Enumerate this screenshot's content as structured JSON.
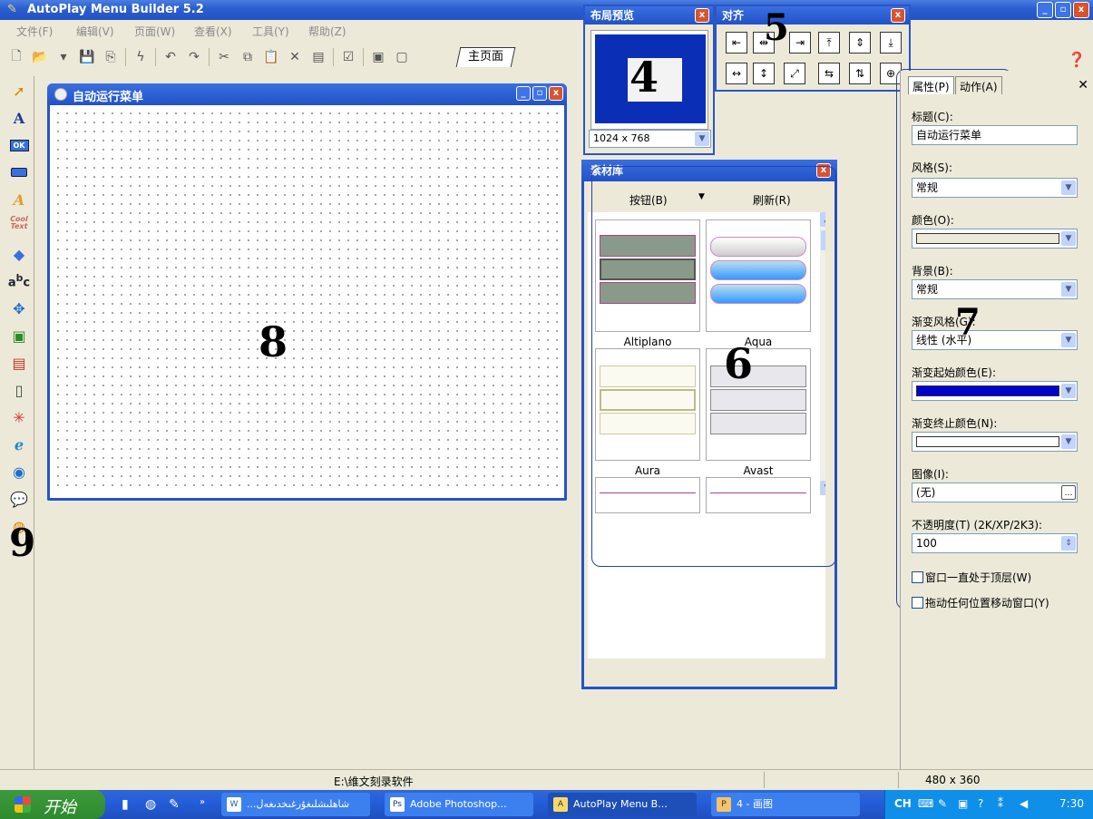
{
  "window": {
    "title": "AutoPlay Menu Builder 5.2",
    "buttons": [
      "_",
      "▫",
      "x"
    ]
  },
  "menu": [
    "文件(F)",
    "编辑(V)",
    "页面(W)",
    "查看(X)",
    "工具(Y)",
    "帮助(Z)"
  ],
  "toolbar": {
    "tab_label": "主页面"
  },
  "document": {
    "title": "自动运行菜单",
    "annotation": "8"
  },
  "toolbox_annotation": "9",
  "layout_preview": {
    "title": "布局预览",
    "resolution": "1024 x 768",
    "annotation": "4"
  },
  "align_panel": {
    "title": "对齐",
    "annotation": "5"
  },
  "library": {
    "title": "素材库",
    "category": "按钮(B)",
    "refresh": "刷新(R)",
    "annotation": "6",
    "items": [
      "Altiplano",
      "Aqua",
      "Aura",
      "Avast"
    ]
  },
  "properties": {
    "tabs": [
      "属性(P)",
      "动作(A)"
    ],
    "annotation": "7",
    "fields": {
      "title_label": "标题(C):",
      "title_value": "自动运行菜单",
      "style_label": "风格(S):",
      "style_value": "常规",
      "color_label": "颜色(O):",
      "bg_label": "背景(B):",
      "bg_value": "常规",
      "grad_style_label": "渐变风格(G):",
      "grad_style_value": "线性 (水平)",
      "grad_start_label": "渐变起始颜色(E):",
      "grad_start_color": "#0000cc",
      "grad_end_label": "渐变终止颜色(N):",
      "image_label": "图像(I):",
      "image_value": "(无)",
      "opacity_label": "不透明度(T) (2K/XP/2K3):",
      "opacity_value": "100",
      "topmost_label": "窗口一直处于顶层(W)",
      "drag_label": "拖动任何位置移动窗口(Y)"
    }
  },
  "statusbar": {
    "path": "E:\\维文刻录软件",
    "size": "480 x 360"
  },
  "taskbar": {
    "start": "开始",
    "tasks": [
      {
        "label": "...شاھلىشلىغۇرغىخدىغەل",
        "icon": "W"
      },
      {
        "label": "Adobe Photoshop...",
        "icon": "Ps"
      },
      {
        "label": "AutoPlay Menu B...",
        "icon": "A"
      },
      {
        "label": "4 - 画图",
        "icon": "P"
      }
    ],
    "lang": "CH",
    "clock": "7:30"
  }
}
